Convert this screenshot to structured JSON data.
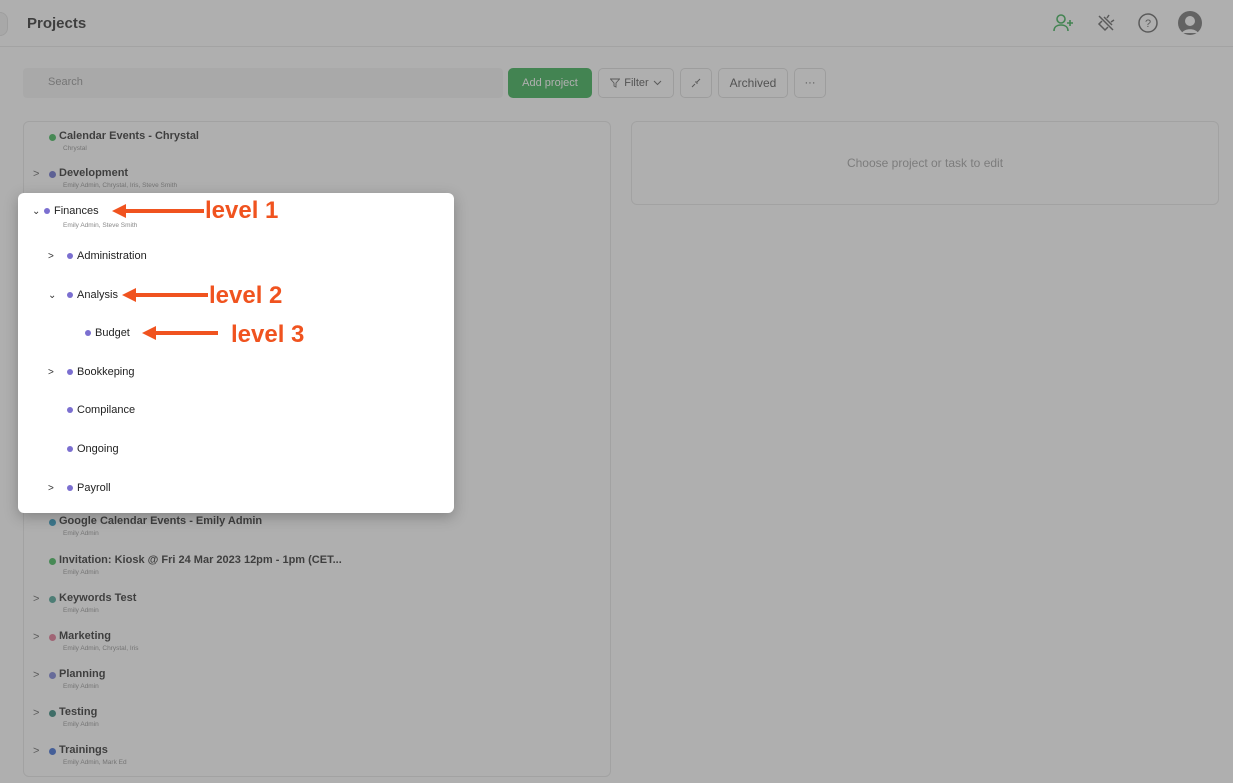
{
  "header": {
    "title": "Projects",
    "icons": [
      "add-user-icon",
      "plug-off-icon",
      "help-icon",
      "avatar"
    ],
    "accent": "#27a844"
  },
  "toolbar": {
    "search_placeholder": "Search",
    "add_label": "Add project",
    "filter_label": "Filter",
    "archived_label": "Archived",
    "more_label": "···"
  },
  "edit_panel": {
    "hint": "Choose project or task to edit"
  },
  "projects": [
    {
      "name": "Calendar Events - Chrystal",
      "members": "Chrystal",
      "color": "#2fb34a",
      "expandable": false
    },
    {
      "name": "Development",
      "members": "Emily Admin, Chrystal, Iris, Steve Smith",
      "color": "#5a62c8",
      "expandable": true
    },
    {
      "name": "Google Calendar Events - Emily Admin",
      "members": "Emily Admin",
      "color": "#1b8fb8",
      "expandable": false
    },
    {
      "name": "Invitation: Kiosk @ Fri 24 Mar 2023 12pm - 1pm (CET...",
      "members": "Emily Admin",
      "color": "#2fb34a",
      "expandable": false
    },
    {
      "name": "Keywords Test",
      "members": "Emily Admin",
      "color": "#3b9a8a",
      "expandable": true
    },
    {
      "name": "Marketing",
      "members": "Emily Admin, Chrystal, Iris",
      "color": "#e06b8b",
      "expandable": true
    },
    {
      "name": "Planning",
      "members": "Emily Admin",
      "color": "#6f76d3",
      "expandable": true
    },
    {
      "name": "Testing",
      "members": "Emily Admin",
      "color": "#1f7a6e",
      "expandable": true
    },
    {
      "name": "Trainings",
      "members": "Emily Admin, Mark Ed",
      "color": "#2b5fd0",
      "expandable": true
    }
  ],
  "tree": {
    "root": {
      "name": "Finances",
      "members": "Emily Admin, Steve Smith"
    },
    "children": [
      {
        "name": "Administration",
        "expandable": true
      },
      {
        "name": "Analysis",
        "expandable": true,
        "expanded": true
      },
      {
        "name": "Budget",
        "level": 3
      },
      {
        "name": "Bookkeping",
        "expandable": true
      },
      {
        "name": "Compilance",
        "expandable": false
      },
      {
        "name": "Ongoing",
        "expandable": false
      },
      {
        "name": "Payroll",
        "expandable": true
      }
    ],
    "dot_color": "#7b6fd0"
  },
  "annotations": {
    "level1": "level 1",
    "level2": "level 2",
    "level3": "level 3",
    "color": "#f0531f"
  }
}
